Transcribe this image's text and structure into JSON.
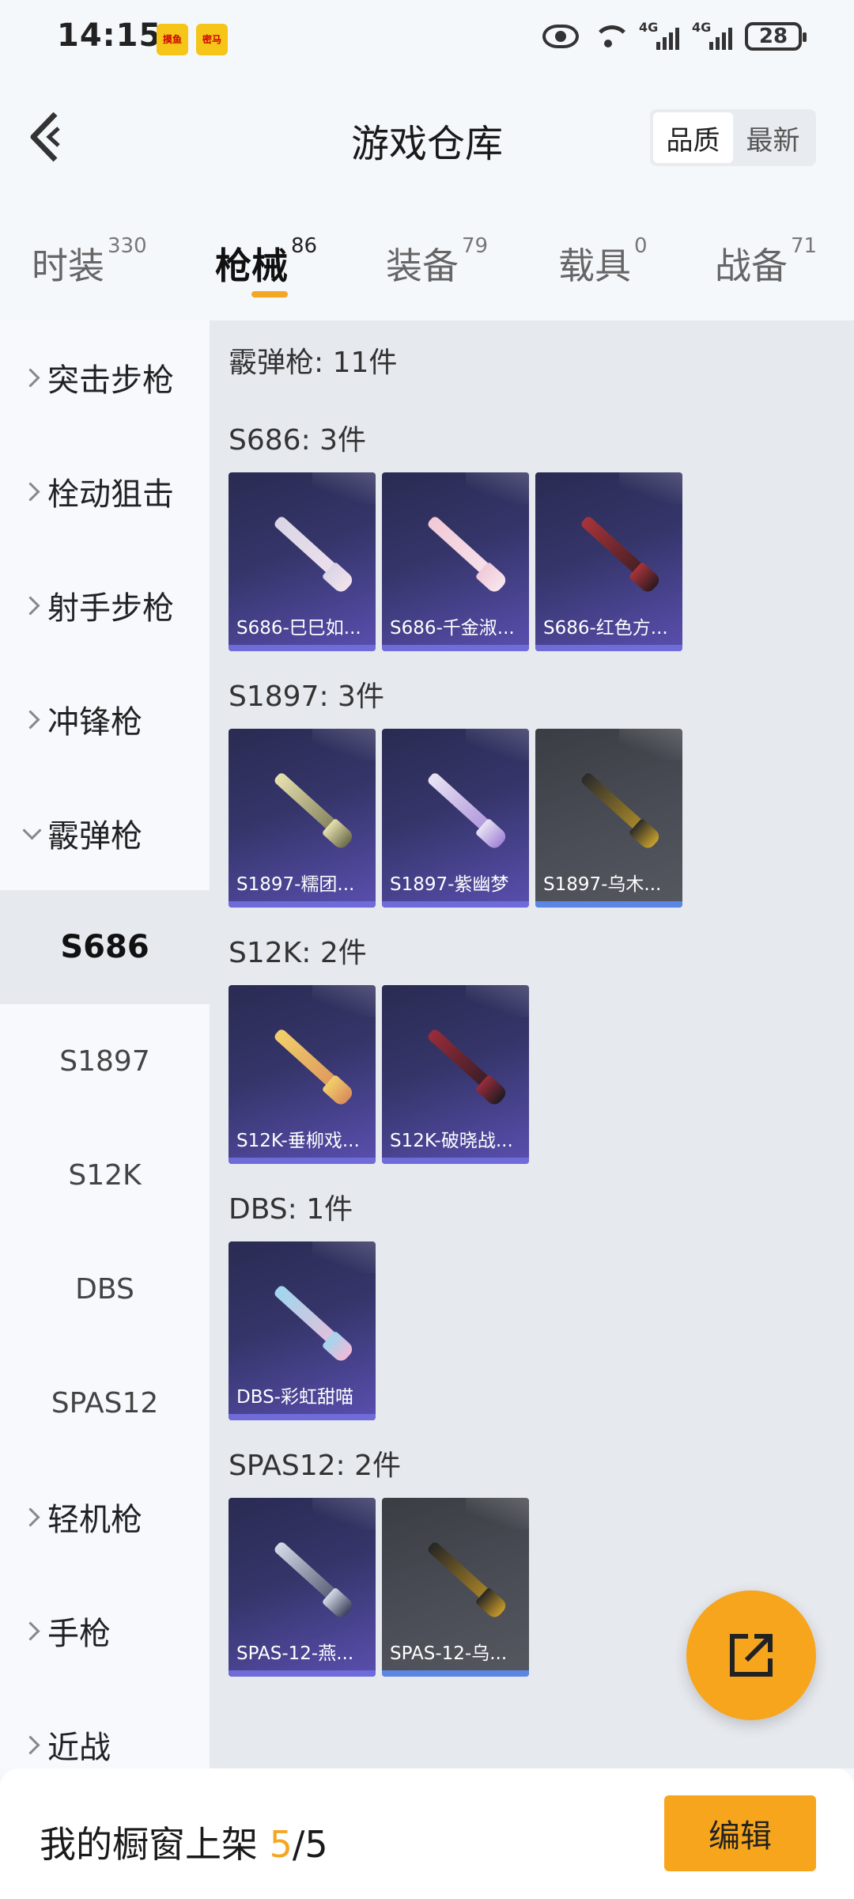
{
  "status": {
    "time": "14:15",
    "app1": "摸鱼",
    "app2": "密马",
    "net1": "4G",
    "net2": "4G",
    "battery": "28"
  },
  "header": {
    "title": "游戏仓库",
    "sort_quality": "品质",
    "sort_latest": "最新"
  },
  "tabs": [
    {
      "label": "时装",
      "count": "330"
    },
    {
      "label": "枪械",
      "count": "86"
    },
    {
      "label": "装备",
      "count": "79"
    },
    {
      "label": "载具",
      "count": "0"
    },
    {
      "label": "战备",
      "count": "71"
    }
  ],
  "sidebar": {
    "items": [
      {
        "label": "突击步枪"
      },
      {
        "label": "栓动狙击"
      },
      {
        "label": "射手步枪"
      },
      {
        "label": "冲锋枪"
      },
      {
        "label": "霰弹枪"
      }
    ],
    "subitems": [
      "S686",
      "S1897",
      "S12K",
      "DBS",
      "SPAS12"
    ],
    "more": [
      {
        "label": "轻机枪"
      },
      {
        "label": "手枪"
      },
      {
        "label": "近战"
      }
    ]
  },
  "content": {
    "category_total": "霰弹枪: 11件",
    "sections": [
      {
        "title": "S686: 3件",
        "cards": [
          "S686-巳巳如...",
          "S686-千金淑...",
          "S686-红色方..."
        ]
      },
      {
        "title": "S1897: 3件",
        "cards": [
          "S1897-糯团...",
          "S1897-紫幽梦",
          "S1897-乌木..."
        ]
      },
      {
        "title": "S12K: 2件",
        "cards": [
          "S12K-垂柳戏...",
          "S12K-破晓战..."
        ]
      },
      {
        "title": "DBS: 1件",
        "cards": [
          "DBS-彩虹甜喵"
        ]
      },
      {
        "title": "SPAS12: 2件",
        "cards": [
          "SPAS-12-燕...",
          "SPAS-12-乌..."
        ]
      }
    ]
  },
  "bottom": {
    "shelf_label": "我的橱窗上架 ",
    "shelf_current": "5",
    "shelf_total": "/5",
    "edit_label": "编辑"
  },
  "colors": {
    "accent": "#f7a51c",
    "card_purple": "#5a4fb0",
    "card_grey": "#4a4d55"
  }
}
